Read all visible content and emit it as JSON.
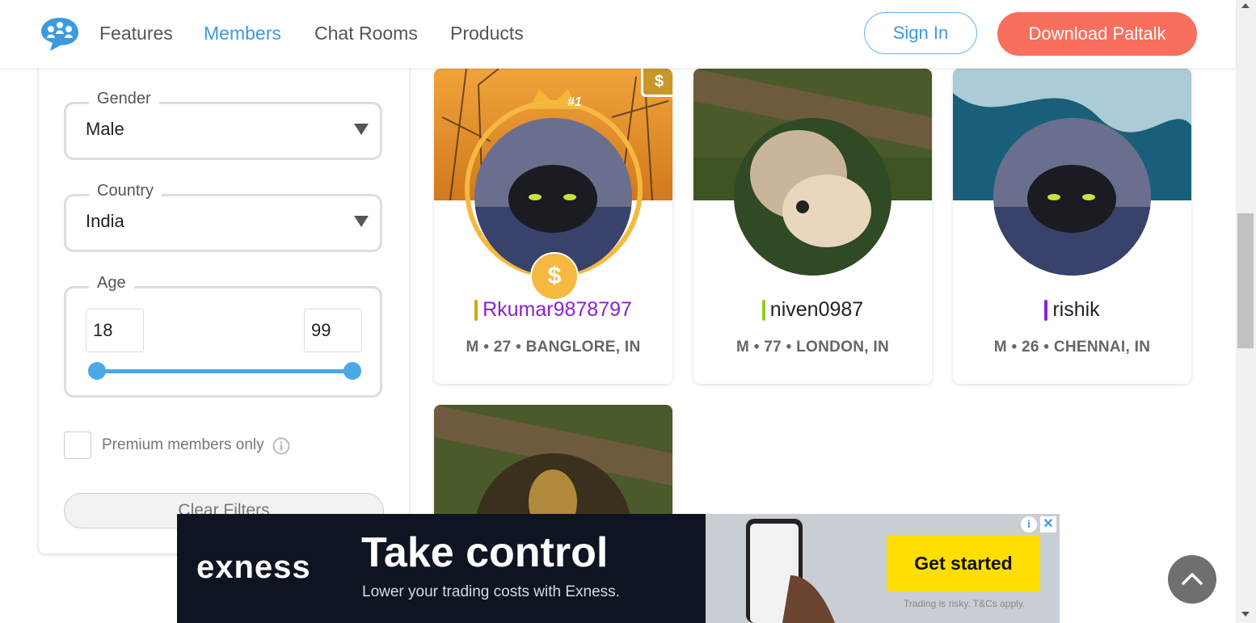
{
  "nav": {
    "logo": "paltalk-logo-icon",
    "items": [
      "Features",
      "Members",
      "Chat Rooms",
      "Products"
    ],
    "active_item": "Members",
    "sign_in": "Sign In",
    "download": "Download Paltalk"
  },
  "filters": {
    "gender": {
      "legend": "Gender",
      "value": "Male"
    },
    "country": {
      "legend": "Country",
      "value": "India"
    },
    "age": {
      "legend": "Age",
      "min": "18",
      "max": "99"
    },
    "premium_label": "Premium members only",
    "clear": "Clear Filters"
  },
  "members": [
    {
      "name": "Rkumar9878797",
      "meta": "M • 27 • BANGLORE, IN",
      "rank": "#1",
      "premium_icon": "$",
      "bar_color": "#d4a514",
      "name_color": "#8b1fd6"
    },
    {
      "name": "niven0987",
      "meta": "M • 77 • LONDON, IN",
      "bar_color": "#8bd01d",
      "name_color": "#222222"
    },
    {
      "name": "rishik",
      "meta": "M • 26 • CHENNAI, IN",
      "bar_color": "#8b1fd6",
      "name_color": "#222222"
    }
  ],
  "ad": {
    "brand": "exness",
    "title": "Take control",
    "subtitle": "Lower your trading costs with Exness.",
    "cta": "Get started",
    "disclaimer": "Trading is risky. T&Cs apply.",
    "info": "i",
    "close": "✕"
  },
  "colors": {
    "accent": "#3a9be0",
    "cta": "#f86f5d",
    "ad_cta": "#ffde02"
  }
}
